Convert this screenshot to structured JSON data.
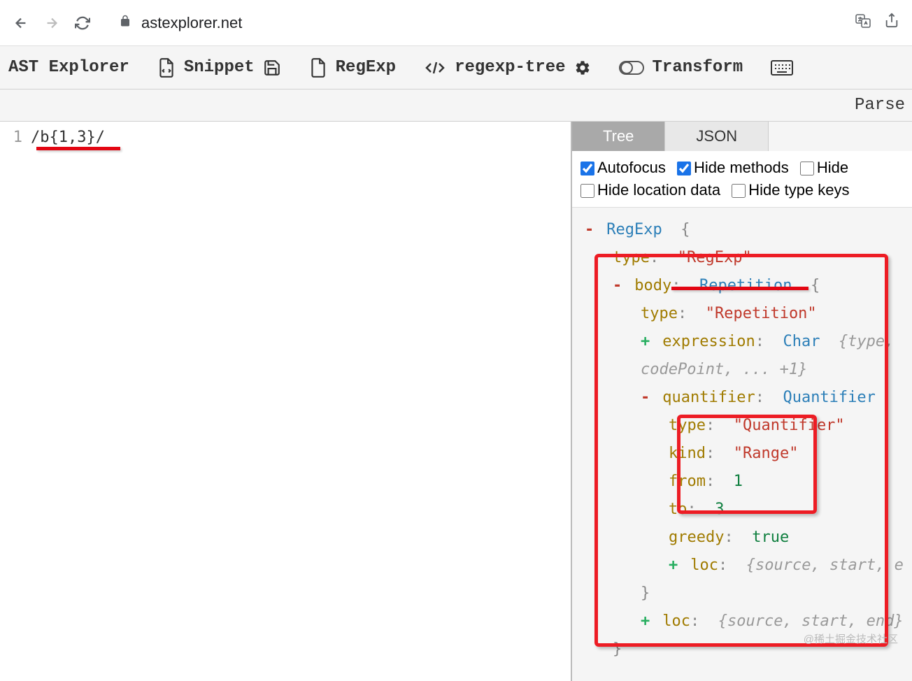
{
  "browser": {
    "url": "astexplorer.net"
  },
  "toolbar": {
    "brand": "AST Explorer",
    "snippet": "Snippet",
    "lang": "RegExp",
    "parser": "regexp-tree",
    "transform": "Transform"
  },
  "subbar": {
    "label": "Parse"
  },
  "editor": {
    "line1_num": "1",
    "line1_code": "/b{1,3}/"
  },
  "panel": {
    "tabs": {
      "tree": "Tree",
      "json": "JSON"
    },
    "options": {
      "autofocus": "Autofocus",
      "hide_methods": "Hide methods",
      "hide_empty": "Hide",
      "hide_location": "Hide location data",
      "hide_type_keys": "Hide type keys"
    }
  },
  "ast": {
    "root": "RegExp",
    "type_key": "type",
    "type_val": "\"RegExp\"",
    "body_key": "body",
    "body_type": "Repetition",
    "body_type_val": "\"Repetition\"",
    "expression_key": "expression",
    "expression_type": "Char",
    "expression_collapsed": "{type,",
    "expression_collapsed2": "codePoint, ... +1}",
    "quantifier_key": "quantifier",
    "quantifier_type": "Quantifier",
    "quantifier_type_val": "\"Quantifier\"",
    "kind_key": "kind",
    "kind_val": "\"Range\"",
    "from_key": "from",
    "from_val": "1",
    "to_key": "to",
    "to_val": "3",
    "greedy_key": "greedy",
    "greedy_val": "true",
    "loc_key": "loc",
    "loc_collapsed": "{source, start, e",
    "loc_collapsed2": "{source, start, end}"
  },
  "watermark": "@稀土掘金技术社区"
}
